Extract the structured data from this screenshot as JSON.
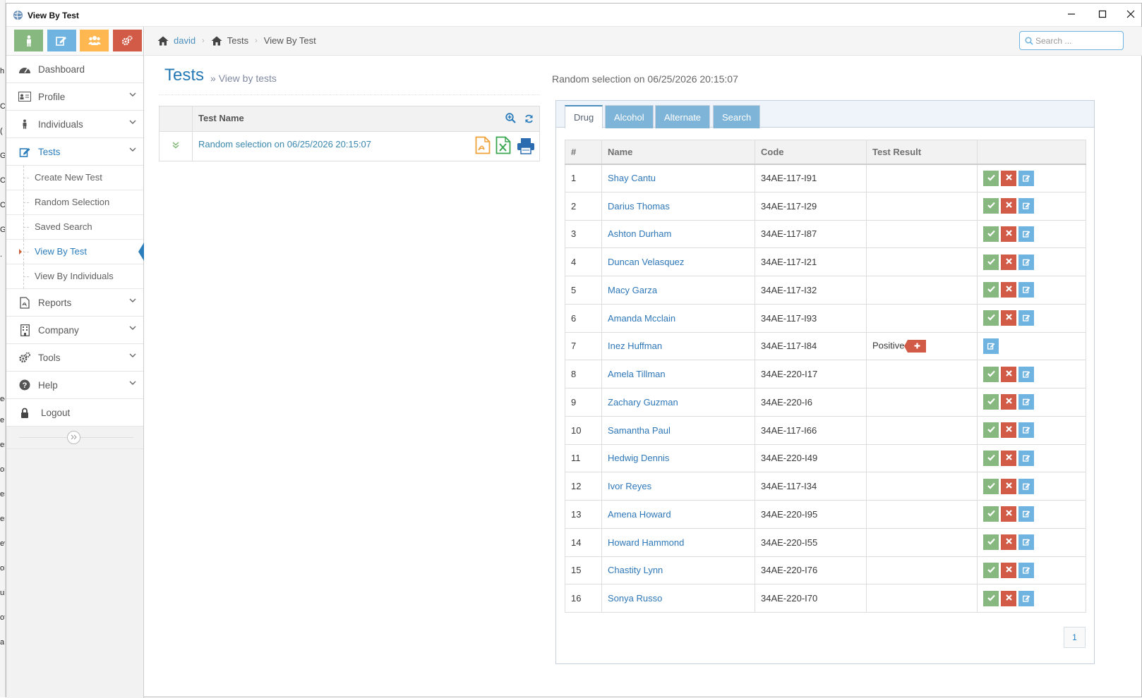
{
  "window": {
    "title": "View By Test"
  },
  "breadcrumb": {
    "home": "david",
    "section": "Tests",
    "current": "View By Test"
  },
  "search": {
    "placeholder": "Search ..."
  },
  "sidebar": {
    "shortcuts": [
      {
        "name": "individual",
        "color": "#87b87f"
      },
      {
        "name": "edit",
        "color": "#6fb3e0"
      },
      {
        "name": "users",
        "color": "#ffb752"
      },
      {
        "name": "cogs",
        "color": "#d15b47"
      }
    ],
    "items": {
      "dashboard": "Dashboard",
      "profile": "Profile",
      "individuals": "Individuals",
      "tests": "Tests",
      "reports": "Reports",
      "company": "Company",
      "tools": "Tools",
      "help": "Help",
      "logout": "Logout"
    },
    "tests_sub": {
      "create": "Create New Test",
      "random": "Random Selection",
      "saved": "Saved Search",
      "view_by_test": "View By Test",
      "view_by_individuals": "View By Individuals"
    }
  },
  "page": {
    "title": "Tests",
    "subtitle": "View by tests"
  },
  "tests_table": {
    "header": "Test Name",
    "rows": [
      {
        "name": "Random selection on 06/25/2026 20:15:07"
      }
    ]
  },
  "detail": {
    "header": "Random selection on 06/25/2026 20:15:07",
    "tabs": [
      "Drug",
      "Alcohol",
      "Alternate",
      "Search"
    ],
    "columns": [
      "#",
      "Name",
      "Code",
      "Test Result"
    ],
    "rows": [
      {
        "n": "1",
        "name": "Shay Cantu",
        "code": "34AE-117-I91",
        "result": ""
      },
      {
        "n": "2",
        "name": "Darius Thomas",
        "code": "34AE-117-I29",
        "result": ""
      },
      {
        "n": "3",
        "name": "Ashton Durham",
        "code": "34AE-117-I87",
        "result": ""
      },
      {
        "n": "4",
        "name": "Duncan Velasquez",
        "code": "34AE-117-I21",
        "result": ""
      },
      {
        "n": "5",
        "name": "Macy Garza",
        "code": "34AE-117-I32",
        "result": ""
      },
      {
        "n": "6",
        "name": "Amanda Mcclain",
        "code": "34AE-117-I93",
        "result": ""
      },
      {
        "n": "7",
        "name": "Inez Huffman",
        "code": "34AE-117-I84",
        "result": "Positive"
      },
      {
        "n": "8",
        "name": "Amela Tillman",
        "code": "34AE-220-I17",
        "result": ""
      },
      {
        "n": "9",
        "name": "Zachary Guzman",
        "code": "34AE-220-I6",
        "result": ""
      },
      {
        "n": "10",
        "name": "Samantha Paul",
        "code": "34AE-117-I66",
        "result": ""
      },
      {
        "n": "11",
        "name": "Hedwig Dennis",
        "code": "34AE-220-I49",
        "result": ""
      },
      {
        "n": "12",
        "name": "Ivor Reyes",
        "code": "34AE-117-I34",
        "result": ""
      },
      {
        "n": "13",
        "name": "Amena Howard",
        "code": "34AE-220-I95",
        "result": ""
      },
      {
        "n": "14",
        "name": "Howard Hammond",
        "code": "34AE-220-I55",
        "result": ""
      },
      {
        "n": "15",
        "name": "Chastity Lynn",
        "code": "34AE-220-I76",
        "result": ""
      },
      {
        "n": "16",
        "name": "Sonya Russo",
        "code": "34AE-220-I70",
        "result": ""
      }
    ],
    "page": "1"
  },
  "colors": {
    "accent": "#2b7dbc",
    "ok": "#87b87f",
    "danger": "#d15b47",
    "info": "#6fb3e0"
  }
}
